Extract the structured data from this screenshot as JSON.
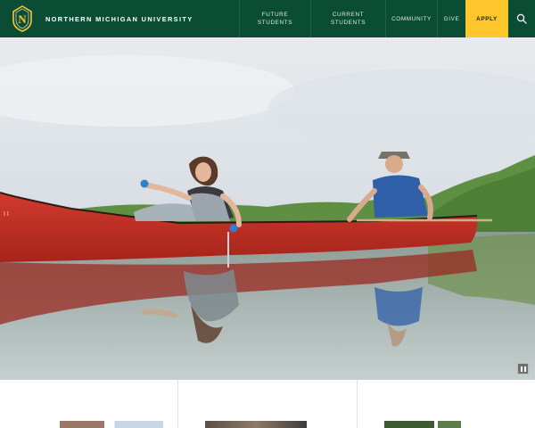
{
  "brand": {
    "name": "NORTHERN MICHIGAN UNIVERSITY",
    "logo_icon": "nmu-shield-logo",
    "colors": {
      "green": "#0b4d34",
      "gold": "#ffc72c"
    }
  },
  "nav": {
    "future_students": "FUTURE STUDENTS",
    "current_students_line1": "CURRENT",
    "current_students_line2": "STUDENTS",
    "community": "COMMUNITY",
    "give": "GIVE",
    "apply": "APPLY",
    "search_icon": "search-icon"
  },
  "hero": {
    "image": "Two people in a red canoe on a calm lake, one taking a water sample",
    "pause_icon": "pause-icon"
  }
}
